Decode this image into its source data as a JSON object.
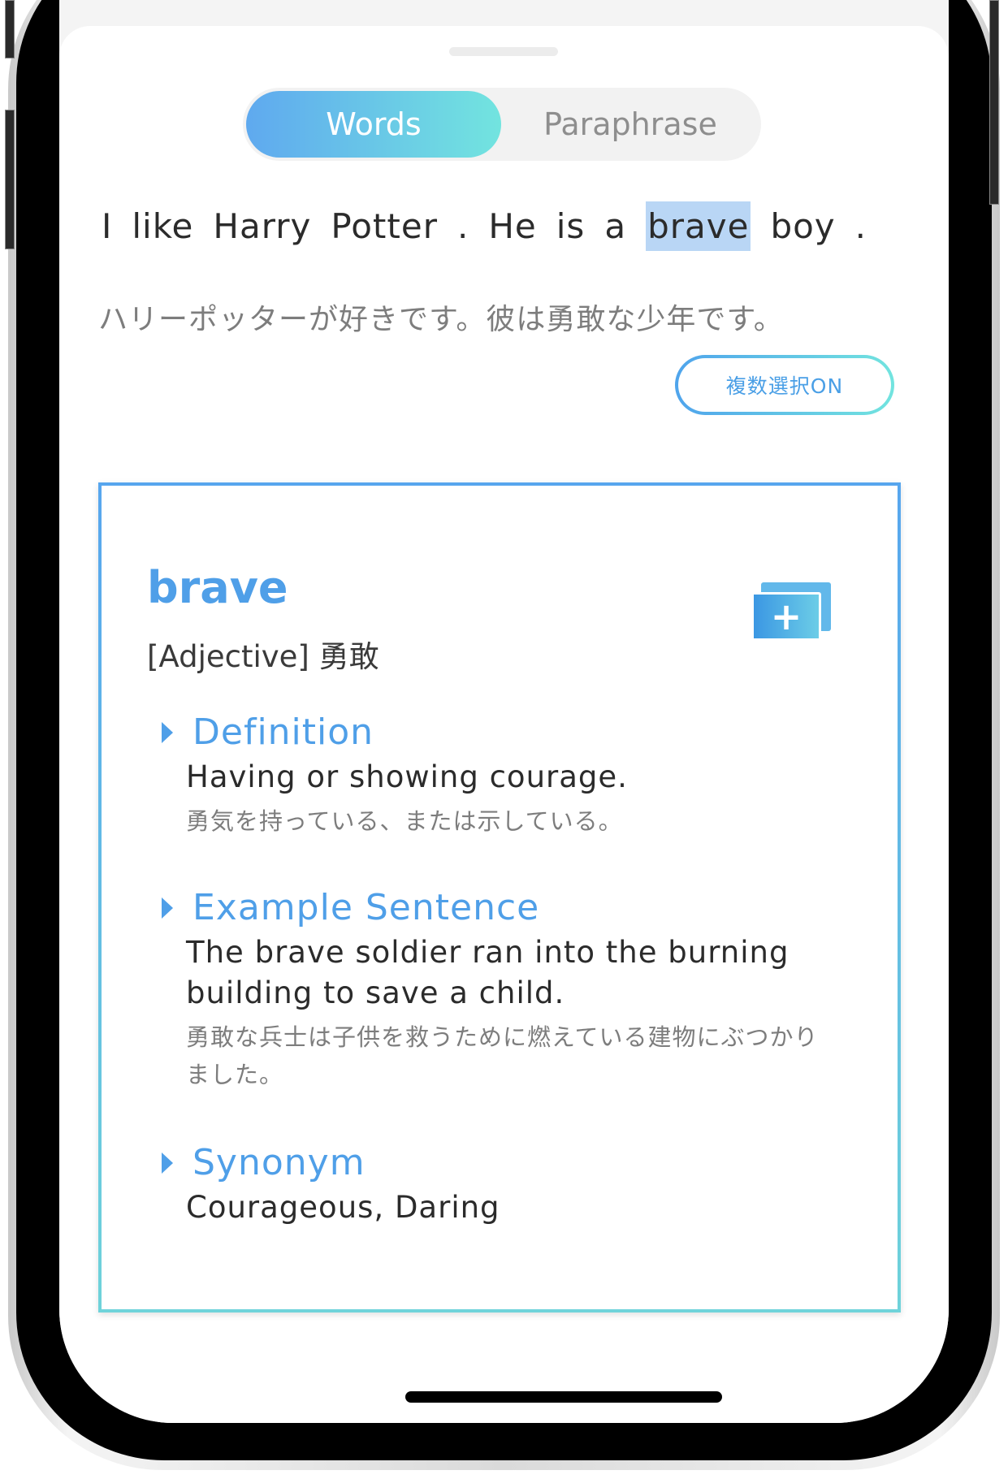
{
  "tabs": {
    "words_label": "Words",
    "paraphrase_label": "Paraphrase",
    "active": "Words"
  },
  "sentence": {
    "tokens": [
      "I",
      "like",
      "Harry",
      "Potter",
      ".",
      "He",
      "is",
      "a",
      "brave",
      "boy",
      "."
    ],
    "selected_token": "brave",
    "translation": "ハリーポッターが好きです。彼は勇敢な少年です。"
  },
  "multi_select_button": {
    "label": "複数選択ON"
  },
  "word_card": {
    "word": "brave",
    "part_of_speech": "[Adjective] 勇敢",
    "add_icon": "add-to-flashcards-icon",
    "sections": [
      {
        "title": "Definition",
        "english": "Having or showing courage.",
        "japanese": "勇気を持っている、または示している。"
      },
      {
        "title": "Example Sentence",
        "english": "The brave soldier ran into the burning building to save a child.",
        "japanese": "勇敢な兵士は子供を救うために燃えている建物にぶつかりました。"
      },
      {
        "title": "Synonym",
        "english": "Courageous, Daring",
        "japanese": ""
      }
    ]
  },
  "colors": {
    "accent_blue": "#4f9fe8",
    "gradient_start": "#5fa9ef",
    "gradient_end": "#72e4df",
    "highlight": "#b9d6f5"
  }
}
